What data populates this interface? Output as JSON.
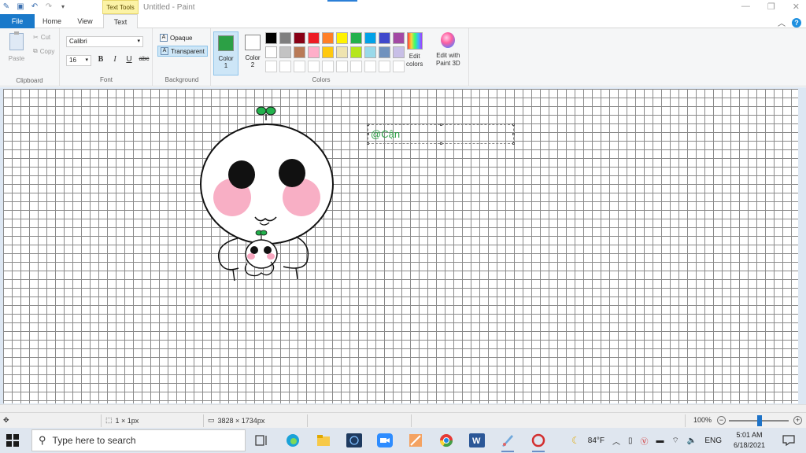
{
  "titlebar": {
    "context_tab": "Text Tools",
    "window_title": "Untitled - Paint"
  },
  "tabs": [
    {
      "label": "File"
    },
    {
      "label": "Home"
    },
    {
      "label": "View"
    },
    {
      "label": "Text"
    }
  ],
  "ribbon": {
    "clipboard": {
      "paste": "Paste",
      "cut": "Cut",
      "copy": "Copy",
      "group": "Clipboard"
    },
    "font": {
      "family": "Calibri",
      "size": "16",
      "bold": "B",
      "italic": "I",
      "underline": "U",
      "strike": "abc",
      "group": "Font"
    },
    "background": {
      "opaque": "Opaque",
      "transparent": "Transparent",
      "group": "Background"
    },
    "colors": {
      "color1_label_line1": "Color",
      "color1_label_line2": "1",
      "color2_label_line1": "Color",
      "color2_label_line2": "2",
      "color1_value": "#2ca045",
      "color2_value": "#ffffff",
      "edit_colors_line1": "Edit",
      "edit_colors_line2": "colors",
      "paint3d_line1": "Edit with",
      "paint3d_line2": "Paint 3D",
      "group": "Colors",
      "palette": [
        "#000000",
        "#7f7f7f",
        "#880015",
        "#ed1c24",
        "#ff7f27",
        "#fff200",
        "#22b14c",
        "#00a2e8",
        "#3f48cc",
        "#a349a4",
        "#ffffff",
        "#c3c3c3",
        "#b97a57",
        "#ffaec9",
        "#ffc90e",
        "#efe4b0",
        "#b5e61d",
        "#99d9ea",
        "#7092be",
        "#c8bfe7",
        "#ffffff",
        "#ffffff",
        "#ffffff",
        "#ffffff",
        "#ffffff",
        "#ffffff",
        "#ffffff",
        "#ffffff",
        "#ffffff",
        "#ffffff"
      ]
    }
  },
  "canvas": {
    "textbox_text": "@Cận"
  },
  "statusbar": {
    "selection_size": "1 × 1px",
    "image_size": "3828 × 1734px",
    "zoom": "100%"
  },
  "taskbar": {
    "search_placeholder": "Type here to search",
    "weather": "84°F",
    "language": "ENG",
    "time": "5:01 AM",
    "date": "6/18/2021"
  }
}
